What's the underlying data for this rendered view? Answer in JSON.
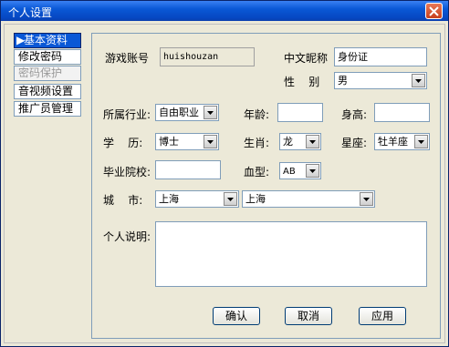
{
  "window": {
    "title": "个人设置"
  },
  "nav": {
    "items": [
      {
        "label": "基本资料",
        "state": "active"
      },
      {
        "label": "修改密码",
        "state": "normal"
      },
      {
        "label": "密码保护",
        "state": "disabled"
      },
      {
        "label": "音视频设置",
        "state": "normal"
      },
      {
        "label": "推广员管理",
        "state": "normal"
      }
    ]
  },
  "form": {
    "account_label": "游戏账号",
    "account_value": "huishouzan",
    "nickname_label": "中文昵称",
    "nickname_value": "身份证",
    "gender_label": "性    别",
    "gender_value": "男",
    "industry_label": "所属行业:",
    "industry_value": "自由职业",
    "age_label": "年龄:",
    "age_value": "",
    "height_label": "身高:",
    "height_value": "",
    "education_label": "学    历:",
    "education_value": "博士",
    "zodiac_label": "生肖:",
    "zodiac_value": "龙",
    "constellation_label": "星座:",
    "constellation_value": "牡羊座",
    "school_label": "毕业院校:",
    "school_value": "",
    "blood_label": "血型:",
    "blood_value": "AB",
    "city_label": "城    市:",
    "province_value": "上海",
    "city_value": "上海",
    "bio_label": "个人说明:",
    "bio_value": ""
  },
  "buttons": {
    "ok": "确认",
    "cancel": "取消",
    "apply": "应用"
  },
  "colors": {
    "titlebar": "#0a58d6",
    "nav_active": "#0a58d6",
    "dialog_bg": "#ece9d8"
  }
}
